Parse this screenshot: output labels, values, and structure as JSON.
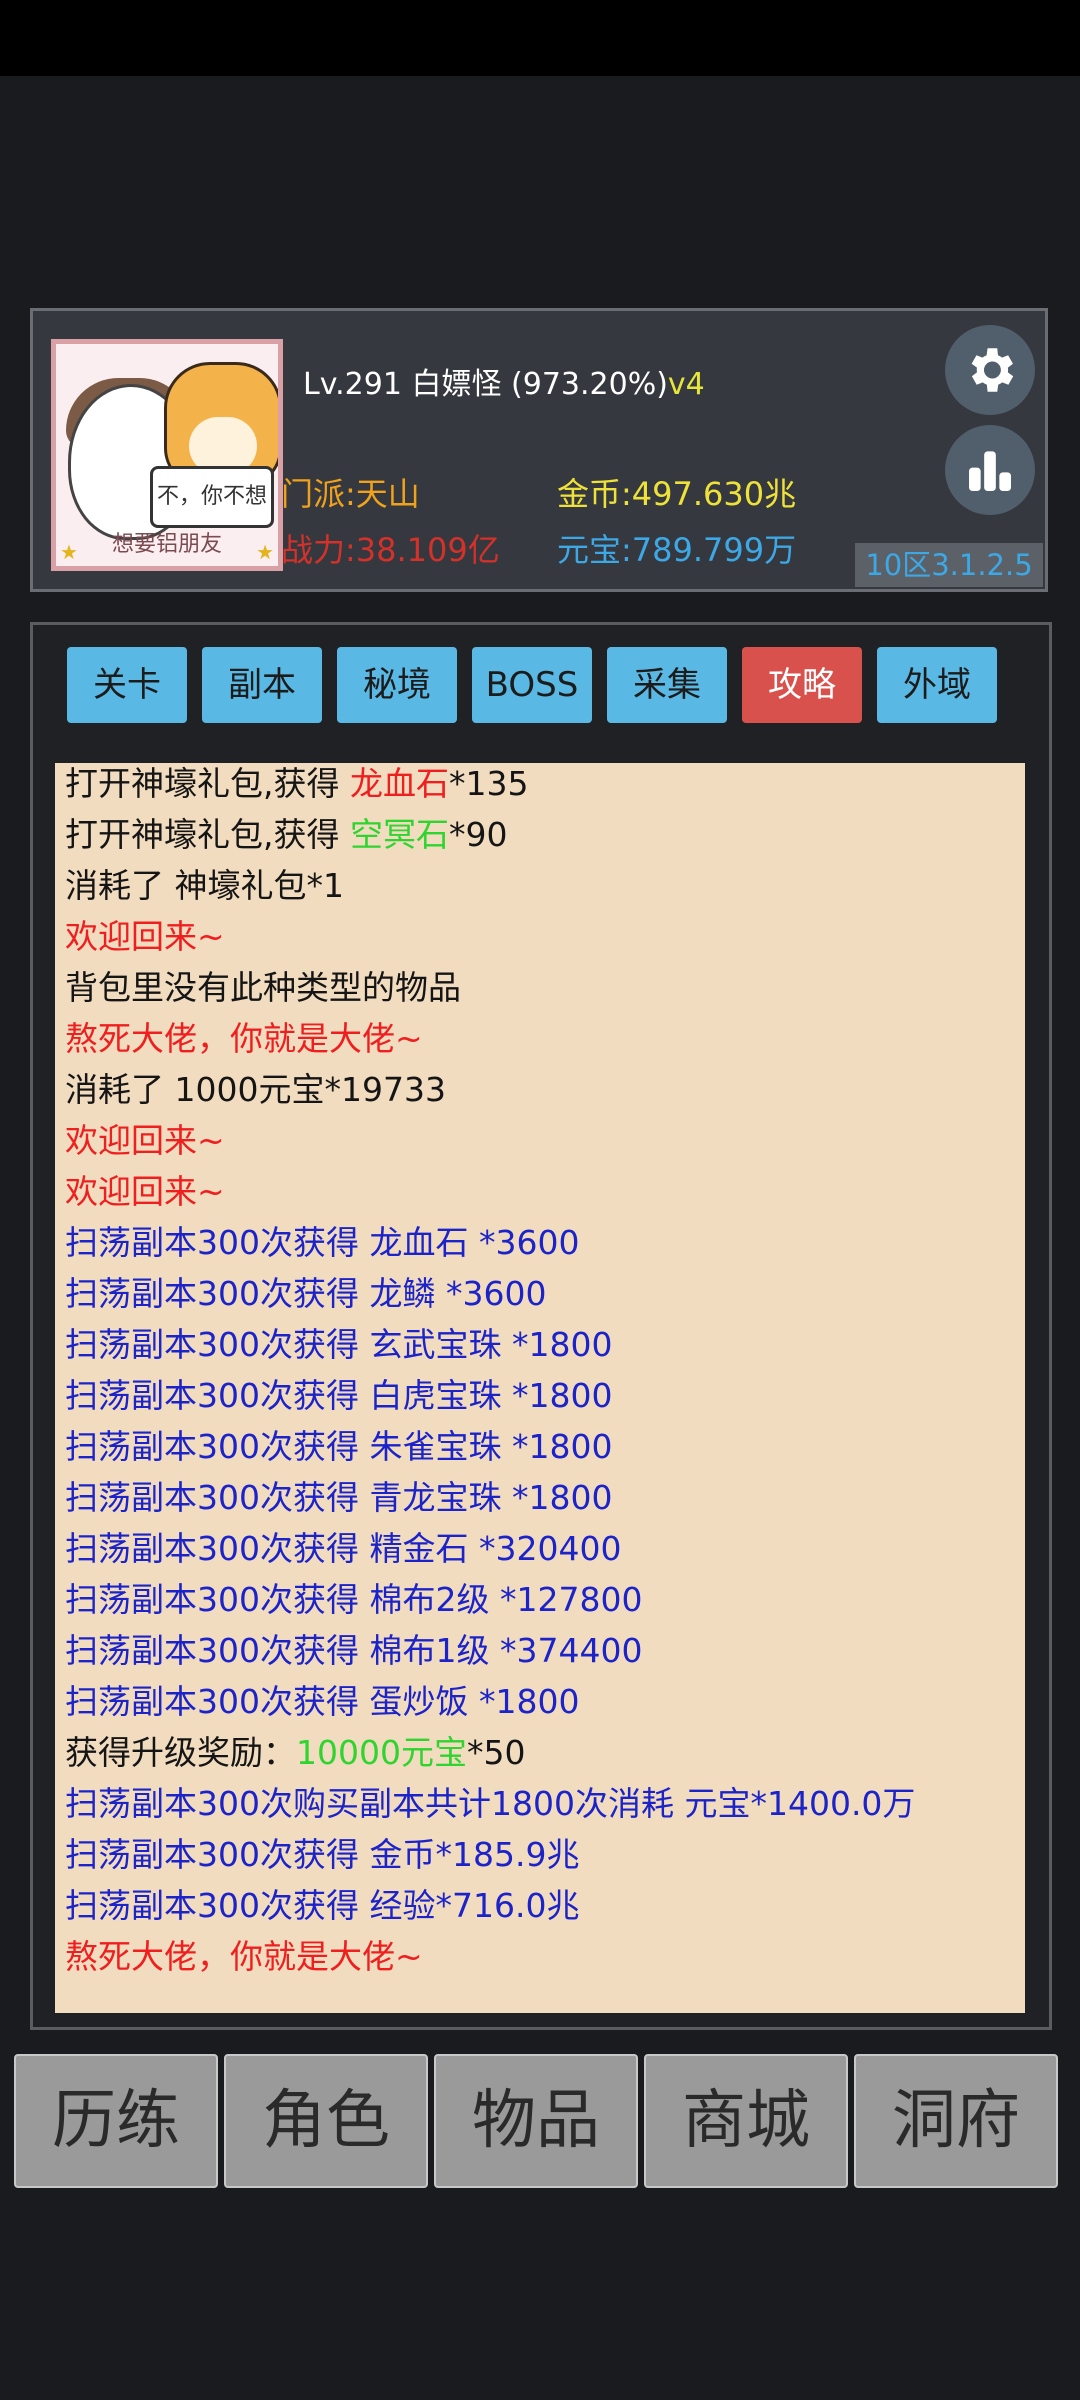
{
  "player": {
    "level_name": "Lv.291  白嫖怪",
    "exp_percent": "(973.20%)",
    "vip": "v4",
    "sect": "门派:天山",
    "power": "战力:38.109亿",
    "gold": "金币:497.630兆",
    "yuanbao": "元宝:789.799万",
    "server": "10区3.1.2.5",
    "avatar": {
      "sign_text": "不，你不想",
      "caption": "想要铝朋友"
    }
  },
  "icons": {
    "settings": "gear-icon",
    "stats": "bar-chart-icon"
  },
  "tabs": [
    {
      "label": "关卡",
      "active": false
    },
    {
      "label": "副本",
      "active": false
    },
    {
      "label": "秘境",
      "active": false
    },
    {
      "label": "BOSS",
      "active": false
    },
    {
      "label": "采集",
      "active": false
    },
    {
      "label": "攻略",
      "active": true
    },
    {
      "label": "外域",
      "active": false
    }
  ],
  "log": [
    {
      "segments": [
        {
          "text": "打开神壕礼包,获得 ",
          "color": "black"
        },
        {
          "text": "龙血石",
          "color": "red"
        },
        {
          "text": "*135",
          "color": "black"
        }
      ]
    },
    {
      "segments": [
        {
          "text": "打开神壕礼包,获得 ",
          "color": "black"
        },
        {
          "text": "空冥石",
          "color": "green"
        },
        {
          "text": "*90",
          "color": "black"
        }
      ]
    },
    {
      "segments": [
        {
          "text": "消耗了 神壕礼包*1",
          "color": "black"
        }
      ]
    },
    {
      "segments": [
        {
          "text": "欢迎回来~",
          "color": "red"
        }
      ]
    },
    {
      "segments": [
        {
          "text": "背包里没有此种类型的物品",
          "color": "black"
        }
      ]
    },
    {
      "segments": [
        {
          "text": "熬死大佬，你就是大佬~",
          "color": "red"
        }
      ]
    },
    {
      "segments": [
        {
          "text": "消耗了 1000元宝*19733",
          "color": "black"
        }
      ]
    },
    {
      "segments": [
        {
          "text": "欢迎回来~",
          "color": "red"
        }
      ]
    },
    {
      "segments": [
        {
          "text": "欢迎回来~",
          "color": "red"
        }
      ]
    },
    {
      "segments": [
        {
          "text": "扫荡副本300次获得 龙血石 *3600",
          "color": "blue"
        }
      ]
    },
    {
      "segments": [
        {
          "text": "扫荡副本300次获得 龙鳞 *3600",
          "color": "blue"
        }
      ]
    },
    {
      "segments": [
        {
          "text": "扫荡副本300次获得 玄武宝珠 *1800",
          "color": "blue"
        }
      ]
    },
    {
      "segments": [
        {
          "text": "扫荡副本300次获得 白虎宝珠 *1800",
          "color": "blue"
        }
      ]
    },
    {
      "segments": [
        {
          "text": "扫荡副本300次获得 朱雀宝珠 *1800",
          "color": "blue"
        }
      ]
    },
    {
      "segments": [
        {
          "text": "扫荡副本300次获得 青龙宝珠 *1800",
          "color": "blue"
        }
      ]
    },
    {
      "segments": [
        {
          "text": "扫荡副本300次获得 精金石 *320400",
          "color": "blue"
        }
      ]
    },
    {
      "segments": [
        {
          "text": "扫荡副本300次获得 棉布2级 *127800",
          "color": "blue"
        }
      ]
    },
    {
      "segments": [
        {
          "text": "扫荡副本300次获得 棉布1级 *374400",
          "color": "blue"
        }
      ]
    },
    {
      "segments": [
        {
          "text": "扫荡副本300次获得 蛋炒饭 *1800",
          "color": "blue"
        }
      ]
    },
    {
      "segments": [
        {
          "text": "获得升级奖励：",
          "color": "black"
        },
        {
          "text": "10000元宝",
          "color": "green"
        },
        {
          "text": "*50",
          "color": "black"
        }
      ]
    },
    {
      "segments": [
        {
          "text": "扫荡副本300次购买副本共计1800次消耗 元宝*1400.0万",
          "color": "blue"
        }
      ]
    },
    {
      "segments": [
        {
          "text": "扫荡副本300次获得 金币*185.9兆",
          "color": "blue"
        }
      ]
    },
    {
      "segments": [
        {
          "text": "扫荡副本300次获得 经验*716.0兆",
          "color": "blue"
        }
      ]
    },
    {
      "segments": [
        {
          "text": "熬死大佬，你就是大佬~",
          "color": "red"
        }
      ]
    }
  ],
  "nav": [
    "历练",
    "角色",
    "物品",
    "商城",
    "洞府"
  ]
}
